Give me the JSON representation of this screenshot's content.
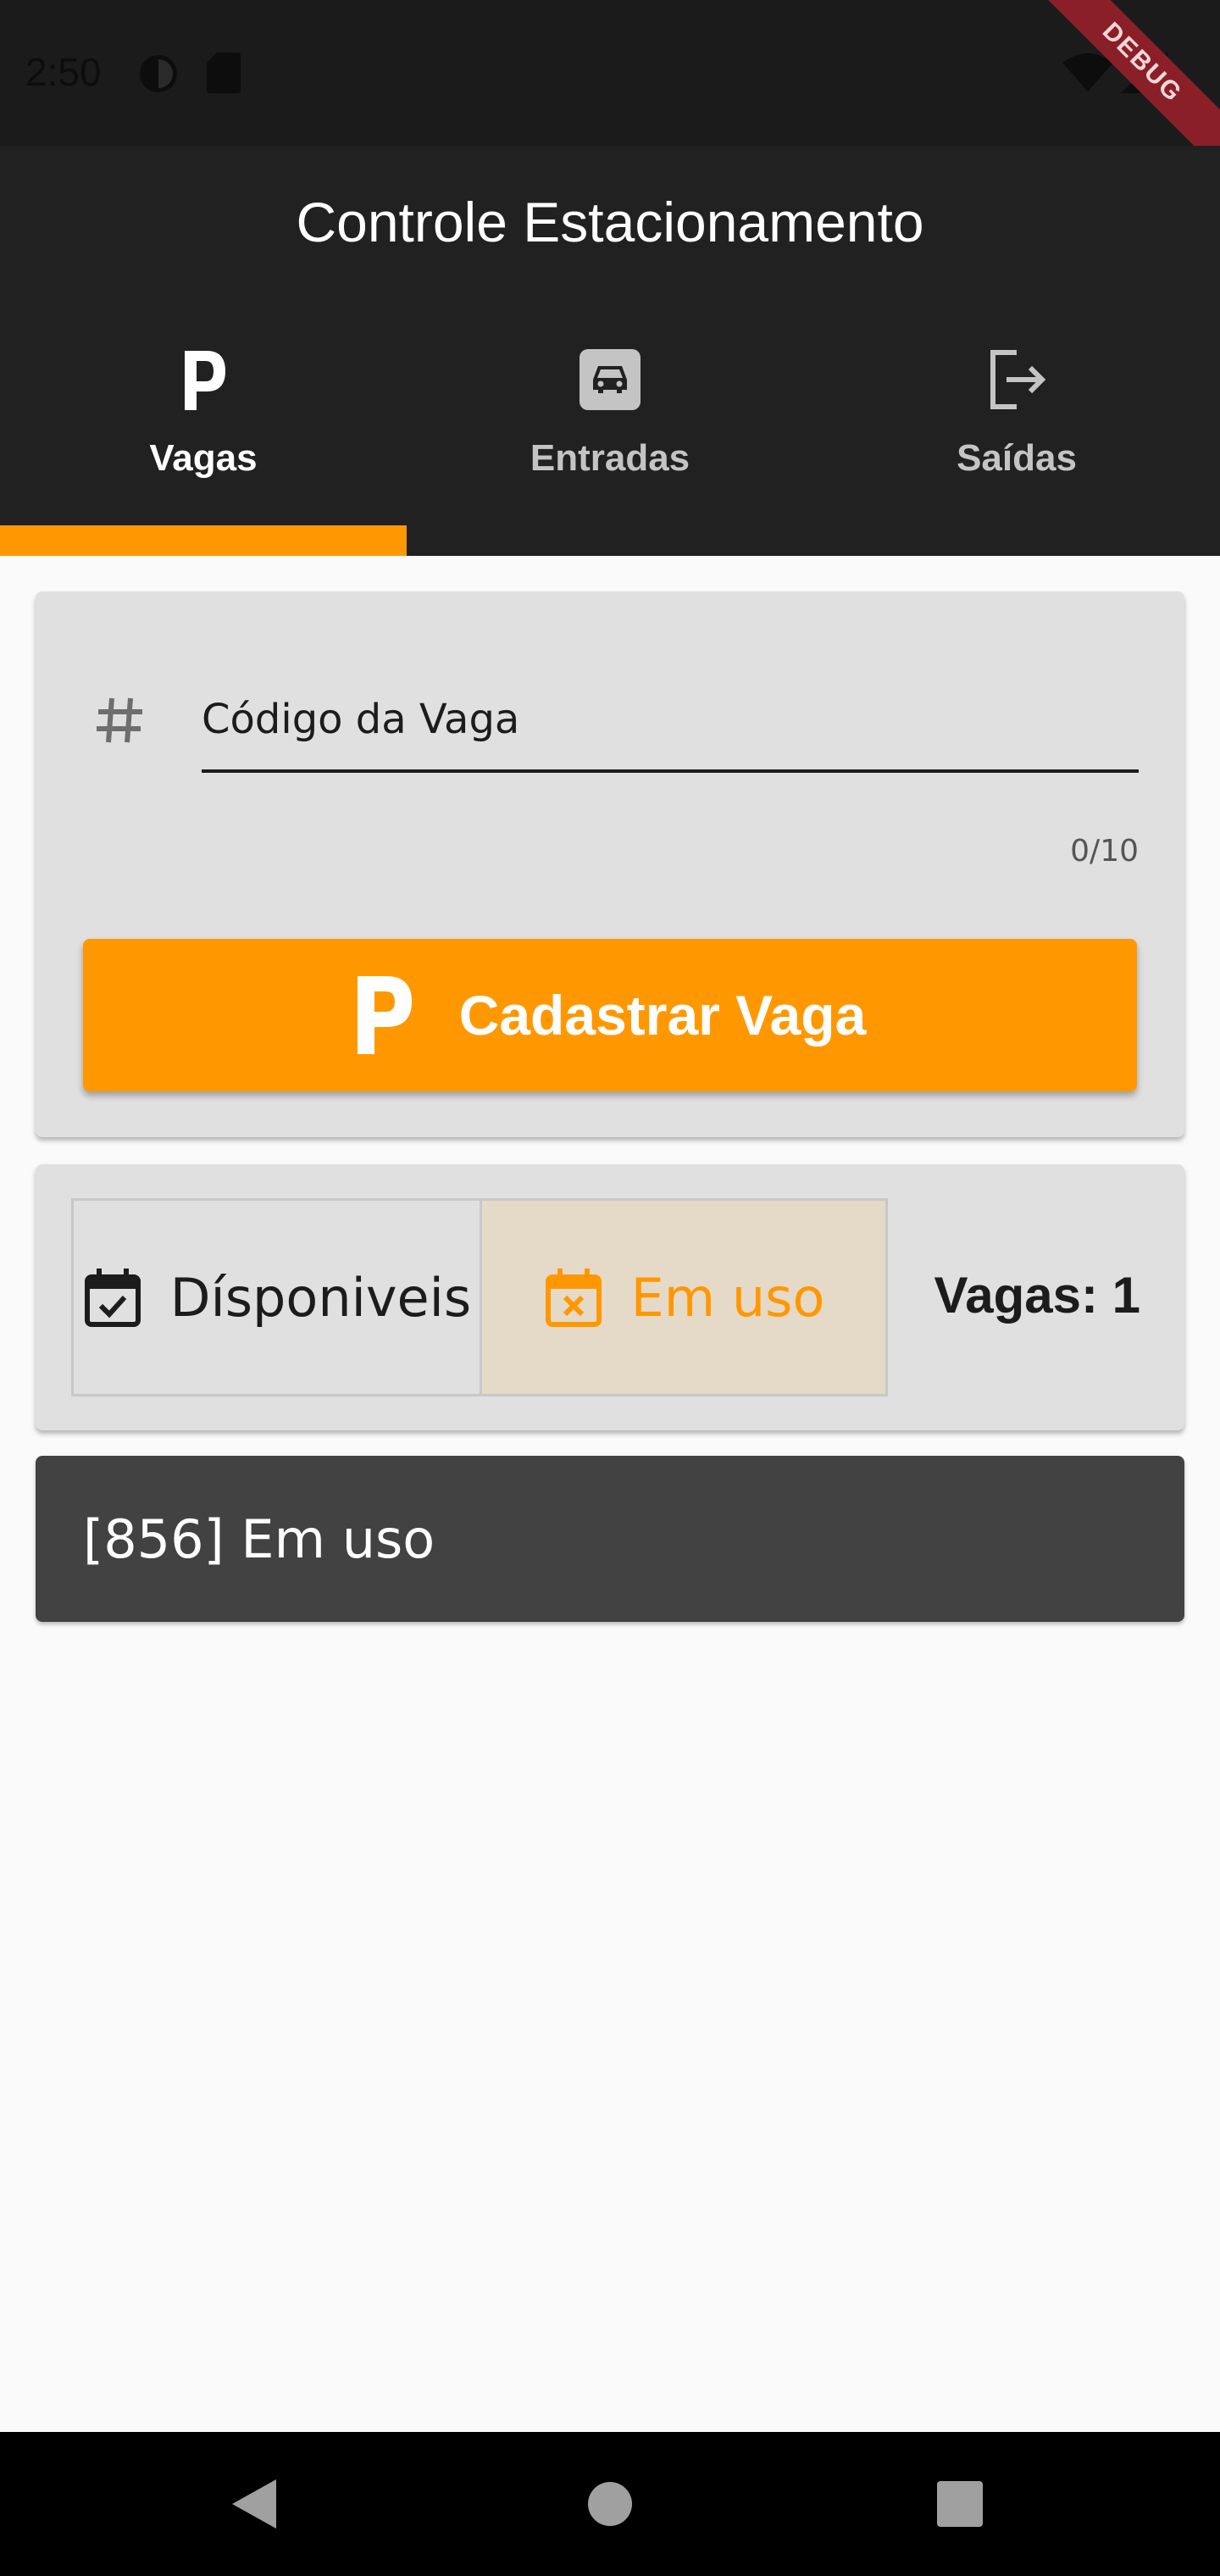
{
  "status_bar": {
    "time": "2:50",
    "debug_label": "DEBUG",
    "icons": [
      "data-saver-icon",
      "sd-card-icon",
      "wifi-icon",
      "battery-icon"
    ]
  },
  "app_bar": {
    "title": "Controle Estacionamento",
    "tabs": [
      {
        "label": "Vagas",
        "icon": "parking-icon",
        "active": true
      },
      {
        "label": "Entradas",
        "icon": "car-icon",
        "active": false
      },
      {
        "label": "Saídas",
        "icon": "exit-icon",
        "active": false
      }
    ]
  },
  "form": {
    "field_icon": "hash-icon",
    "code_placeholder": "Código da Vaga",
    "code_value": "",
    "counter": "0/10",
    "register_label": "Cadastrar Vaga",
    "register_icon": "parking-icon"
  },
  "filter": {
    "available_label": "Dísponiveis",
    "available_icon": "event-available-icon",
    "in_use_label": "Em uso",
    "in_use_icon": "event-busy-icon",
    "selected": "in_use",
    "count_text": "Vagas: 1"
  },
  "spots": [
    {
      "label": "[856] Em uso"
    }
  ],
  "colors": {
    "accent": "#ff9800",
    "app_bar": "#212121",
    "card": "#e0e0e0",
    "list_item": "#424242",
    "selected_toggle_bg": "#e5d9c8"
  },
  "nav_bar": {
    "buttons": [
      "back-icon",
      "home-icon",
      "recents-icon"
    ]
  }
}
